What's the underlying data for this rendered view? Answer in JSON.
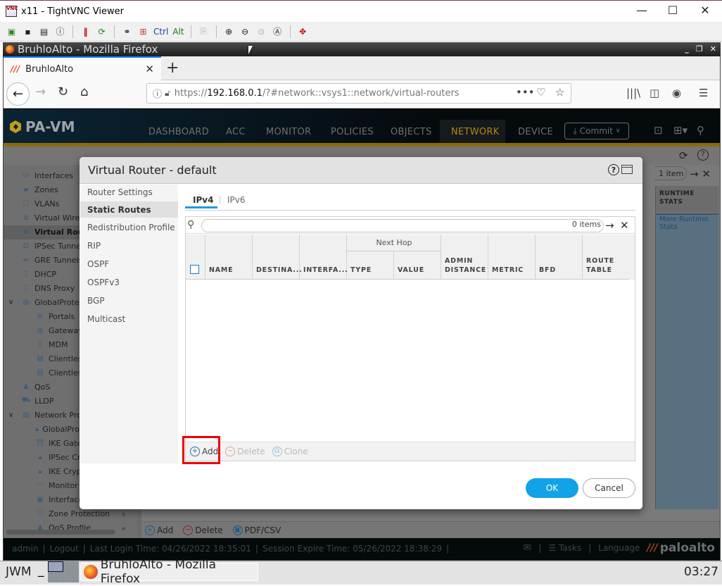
{
  "vnc": {
    "title": "x11 - TightVNC Viewer",
    "icon_label": "VNC",
    "window_controls": {
      "minimize": "—",
      "maximize": "☐",
      "close": "✕"
    },
    "toolbar_icons": [
      "new-connection-icon",
      "save-icon",
      "options-icon",
      "info-icon",
      "pause-icon",
      "refresh-icon",
      "transfer-icon",
      "windows-key-icon",
      "ctrl-key",
      "alt-key",
      "copy-icon",
      "zoom-in-icon",
      "zoom-out-icon",
      "zoom-100-icon",
      "zoom-auto-icon",
      "fullscreen-icon"
    ],
    "ctrl_label": "Ctrl",
    "alt_label": "Alt"
  },
  "firefox": {
    "window_title": "BruhloAlto - Mozilla Firefox",
    "tab_title": "BruhloAlto",
    "url_prefix": "https://",
    "url_host": "192.168.0.1",
    "url_path": "/?#network::vsys1::network/virtual-routers"
  },
  "pa": {
    "logo": "PA-VM",
    "nav": [
      "DASHBOARD",
      "ACC",
      "MONITOR",
      "POLICIES",
      "OBJECTS",
      "NETWORK",
      "DEVICE"
    ],
    "active_nav": "NETWORK",
    "commit_label": "Commit",
    "sidebar": [
      {
        "label": "Interfaces",
        "icon": "interfaces-icon"
      },
      {
        "label": "Zones",
        "icon": "zones-icon"
      },
      {
        "label": "VLANs",
        "icon": "vlans-icon"
      },
      {
        "label": "Virtual Wires",
        "icon": "virtual-wires-icon"
      },
      {
        "label": "Virtual Routers",
        "icon": "virtual-routers-icon",
        "active": true
      },
      {
        "label": "IPSec Tunnels",
        "icon": "ipsec-tunnels-icon"
      },
      {
        "label": "GRE Tunnels",
        "icon": "gre-tunnels-icon"
      },
      {
        "label": "DHCP",
        "icon": "dhcp-icon"
      },
      {
        "label": "DNS Proxy",
        "icon": "dns-proxy-icon"
      },
      {
        "label": "GlobalProtect",
        "icon": "globalprotect-icon",
        "expanded": true
      },
      {
        "label": "Portals",
        "icon": "portals-icon"
      },
      {
        "label": "Gateways",
        "icon": "gateways-icon"
      },
      {
        "label": "MDM",
        "icon": "mdm-icon"
      },
      {
        "label": "Clientless Apps",
        "icon": "clientless-apps-icon"
      },
      {
        "label": "Clientless App Groups",
        "icon": "clientless-groups-icon"
      },
      {
        "label": "QoS",
        "icon": "qos-icon"
      },
      {
        "label": "LLDP",
        "icon": "lldp-icon"
      },
      {
        "label": "Network Profiles",
        "icon": "network-profiles-icon",
        "expanded": true
      },
      {
        "label": "GlobalProtect IPSec Crypto",
        "icon": "lock-icon"
      },
      {
        "label": "IKE Gateways",
        "icon": "ike-gateways-icon"
      },
      {
        "label": "IPSec Crypto",
        "icon": "lock-icon"
      },
      {
        "label": "IKE Crypto",
        "icon": "lock-icon"
      },
      {
        "label": "Monitor",
        "icon": "monitor-icon"
      },
      {
        "label": "Interface Mgmt",
        "icon": "interface-mgmt-icon"
      },
      {
        "label": "Zone Protection",
        "icon": "zone-protection-icon"
      },
      {
        "label": "QoS Profile",
        "icon": "qos-profile-icon"
      }
    ],
    "list_count": "1 item",
    "runtime_stats_header": "RUNTIME STATS",
    "runtime_stats_link": "More Runtime Stats",
    "bottom_actions": {
      "add": "Add",
      "delete": "Delete",
      "pdf": "PDF/CSV"
    },
    "footer": {
      "user": "admin",
      "logout": "Logout",
      "last_login": "Last Login Time: 04/26/2022 18:35:01",
      "session_expire": "Session Expire Time: 05/26/2022 18:38:29",
      "tasks": "Tasks",
      "language": "Language",
      "brand": "paloalto"
    }
  },
  "modal": {
    "title": "Virtual Router - default",
    "side_items": [
      "Router Settings",
      "Static Routes",
      "Redistribution Profile",
      "RIP",
      "OSPF",
      "OSPFv3",
      "BGP",
      "Multicast"
    ],
    "active_side": "Static Routes",
    "tabs": [
      "IPv4",
      "IPv6"
    ],
    "active_tab": "IPv4",
    "search_placeholder": "",
    "items_count": "0 items",
    "group_header": "Next Hop",
    "columns": [
      "NAME",
      "DESTINA...",
      "INTERFA...",
      "TYPE",
      "VALUE",
      "ADMIN DISTANCE",
      "METRIC",
      "BFD",
      "ROUTE TABLE"
    ],
    "rows": [],
    "actions": {
      "add": "Add",
      "delete": "Delete",
      "clone": "Clone"
    },
    "ok": "OK",
    "cancel": "Cancel"
  },
  "taskbar": {
    "wm": "JWM",
    "min": "_",
    "task": "BruhloAlto - Mozilla Firefox",
    "clock": "03:27"
  }
}
